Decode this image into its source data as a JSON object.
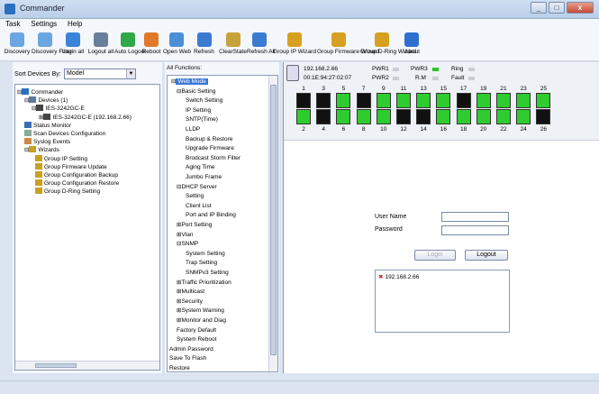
{
  "window": {
    "title": "Commander",
    "btn_min": "_",
    "btn_max": "□",
    "btn_close": "x"
  },
  "menu": [
    "Task",
    "Settings",
    "Help"
  ],
  "toolbar": [
    {
      "label": "Discovery",
      "icon": "magnifier-icon"
    },
    {
      "label": "Discovery Filter",
      "icon": "magnifier-filter-icon"
    },
    {
      "label": "Login all",
      "icon": "user-login-icon"
    },
    {
      "label": "Logout all",
      "icon": "user-logout-icon"
    },
    {
      "label": "Auto Logout",
      "icon": "auto-logout-icon"
    },
    {
      "label": "Reboot",
      "icon": "reboot-icon"
    },
    {
      "label": "Open Web",
      "icon": "open-web-icon"
    },
    {
      "label": "Refresh",
      "icon": "refresh-icon"
    },
    {
      "label": "ClearState",
      "icon": "clear-state-icon"
    },
    {
      "label": "Refresh All",
      "icon": "refresh-all-icon"
    },
    {
      "label": "Group IP Wizard",
      "icon": "wand-icon"
    },
    {
      "label": "Group Firmware Wizard",
      "icon": "wand-icon"
    },
    {
      "label": "Group D-Ring Wizard",
      "icon": "wand-icon"
    },
    {
      "label": "About",
      "icon": "info-icon"
    }
  ],
  "sort": {
    "label": "Sort Devices By:",
    "value": "Model"
  },
  "device_tree": [
    {
      "label": "Commander",
      "icon": "commander-icon",
      "expander": "⊟"
    },
    {
      "label": "Devices (1)",
      "icon": "devices-icon",
      "expander": "⊟"
    },
    {
      "label": "IES-3242GC-E",
      "icon": "switch-icon",
      "expander": "⊟"
    },
    {
      "label": "IES-3242GC-E (192.168.2.66)",
      "icon": "switch-icon",
      "expander": "⊞"
    },
    {
      "label": "Status Monitor",
      "icon": "monitor-icon",
      "expander": ""
    },
    {
      "label": "Scan Devices Configuration",
      "icon": "scan-icon",
      "expander": ""
    },
    {
      "label": "Syslog Events",
      "icon": "syslog-icon",
      "expander": ""
    },
    {
      "label": "Wizards",
      "icon": "wizard-icon",
      "expander": "⊟"
    },
    {
      "label": "Group IP Setting",
      "icon": "wand-icon",
      "expander": ""
    },
    {
      "label": "Group Firmware Update",
      "icon": "wand-icon",
      "expander": ""
    },
    {
      "label": "Group Configuration Backup",
      "icon": "wand-icon",
      "expander": ""
    },
    {
      "label": "Group Configuration Restore",
      "icon": "wand-icon",
      "expander": ""
    },
    {
      "label": "Group D-Ring Setting",
      "icon": "wand-icon",
      "expander": ""
    }
  ],
  "functions": {
    "label": "All Functions:",
    "items": [
      {
        "label": "Web Mode",
        "expander": "⊟",
        "selected": true
      },
      {
        "label": "Basic Setting",
        "expander": "⊟"
      },
      {
        "label": "Switch Setting",
        "expander": ""
      },
      {
        "label": "IP Setting",
        "expander": ""
      },
      {
        "label": "SNTP(Time)",
        "expander": ""
      },
      {
        "label": "LLDP",
        "expander": ""
      },
      {
        "label": "Backup & Restore",
        "expander": ""
      },
      {
        "label": "Upgrade Firmware",
        "expander": ""
      },
      {
        "label": "Brodcast Storm Filter",
        "expander": ""
      },
      {
        "label": "Aging Time",
        "expander": ""
      },
      {
        "label": "Jumbo Frame",
        "expander": ""
      },
      {
        "label": "DHCP Server",
        "expander": "⊟"
      },
      {
        "label": "Setting",
        "expander": ""
      },
      {
        "label": "Client List",
        "expander": ""
      },
      {
        "label": "Port and IP Binding",
        "expander": ""
      },
      {
        "label": "Port Setting",
        "expander": "⊞"
      },
      {
        "label": "Vlan",
        "expander": "⊞"
      },
      {
        "label": "SNMP",
        "expander": "⊟"
      },
      {
        "label": "System Setting",
        "expander": ""
      },
      {
        "label": "Trap Setting",
        "expander": ""
      },
      {
        "label": "SNMPv3 Setting",
        "expander": ""
      },
      {
        "label": "Traffic Prioritization",
        "expander": "⊞"
      },
      {
        "label": "Multicast",
        "expander": "⊞"
      },
      {
        "label": "Security",
        "expander": "⊞"
      },
      {
        "label": "System Warning",
        "expander": "⊞"
      },
      {
        "label": "Monitor and Diag",
        "expander": "⊞"
      },
      {
        "label": "Factory Default",
        "expander": ""
      },
      {
        "label": "System Reboot",
        "expander": ""
      },
      {
        "label": "Admin Password",
        "expander": ""
      },
      {
        "label": "Save To Flash",
        "expander": ""
      },
      {
        "label": "Restore",
        "expander": ""
      }
    ]
  },
  "device_info": {
    "ip": "192.168.2.66",
    "mac": "00:1E:94:27:02:07",
    "pwr1": "PWR1",
    "pwr2": "PWR2",
    "pwr3": "PWR3",
    "rm": "R.M",
    "ring": "Ring",
    "fault": "Fault",
    "colors": {
      "led_on": "#28c828",
      "led_off": "#c9ced6",
      "port_up": "#2ecc2e",
      "port_down": "#111111"
    }
  },
  "ports": {
    "top": [
      {
        "n": "1",
        "up": false
      },
      {
        "n": "3",
        "up": false
      },
      {
        "n": "5",
        "up": true
      },
      {
        "n": "7",
        "up": false
      },
      {
        "n": "9",
        "up": true
      },
      {
        "n": "11",
        "up": true
      },
      {
        "n": "13",
        "up": true
      },
      {
        "n": "15",
        "up": true
      },
      {
        "n": "17",
        "up": false
      },
      {
        "n": "19",
        "up": true
      },
      {
        "n": "21",
        "up": true
      },
      {
        "n": "23",
        "up": true
      },
      {
        "n": "25",
        "up": true
      }
    ],
    "bottom": [
      {
        "n": "2",
        "up": true
      },
      {
        "n": "4",
        "up": false
      },
      {
        "n": "6",
        "up": true
      },
      {
        "n": "8",
        "up": true
      },
      {
        "n": "10",
        "up": true
      },
      {
        "n": "12",
        "up": false
      },
      {
        "n": "14",
        "up": false
      },
      {
        "n": "16",
        "up": true
      },
      {
        "n": "18",
        "up": true
      },
      {
        "n": "20",
        "up": true
      },
      {
        "n": "22",
        "up": true
      },
      {
        "n": "24",
        "up": true
      },
      {
        "n": "26",
        "up": false
      }
    ]
  },
  "login": {
    "user_label": "User Name",
    "password_label": "Password",
    "user_value": "",
    "password_value": "",
    "login_btn": "Login",
    "logout_btn": "Logout",
    "messages": [
      "192.168.2.66"
    ]
  }
}
